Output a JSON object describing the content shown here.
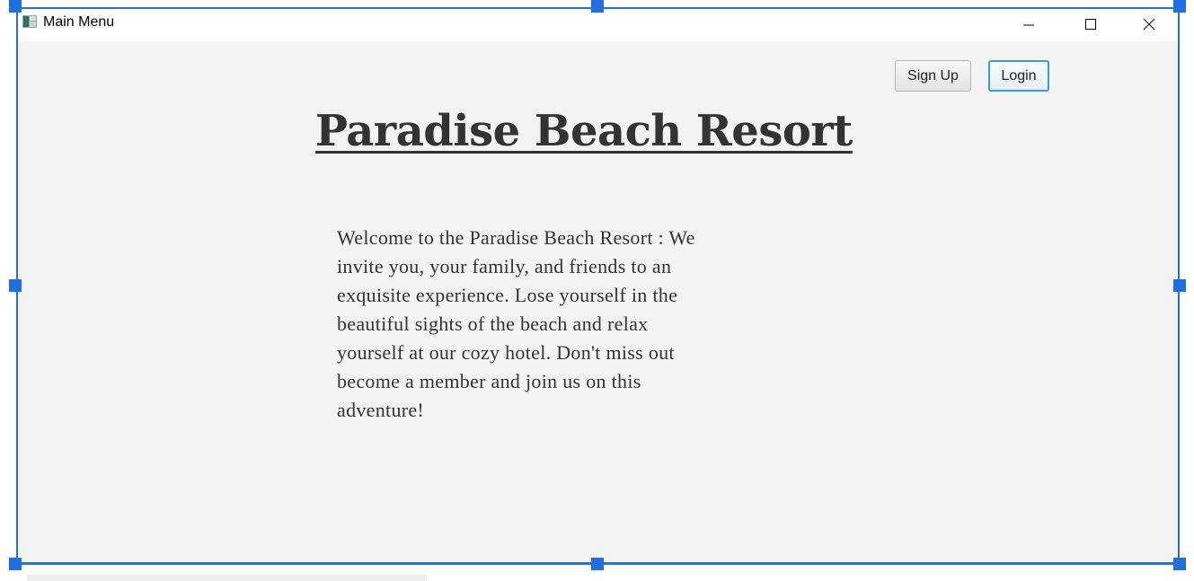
{
  "window": {
    "title": "Main Menu",
    "controls": {
      "minimize": "minimize-icon",
      "maximize": "maximize-icon",
      "close": "close-icon"
    }
  },
  "header": {
    "signup_label": "Sign Up",
    "login_label": "Login"
  },
  "main": {
    "heading": "Paradise Beach Resort",
    "welcome_lines": [
      "Welcome to the Paradise Beach Resort : We",
      "invite you, your family, and friends to an",
      "exquisite experience. Lose yourself in the",
      "beautiful sights of the beach and relax",
      "yourself at our cozy hotel. Don't miss out",
      "become a member and join us on this",
      "adventure!"
    ]
  },
  "colors": {
    "selection": "#2a6fd6",
    "focus_border": "#3d9ad8",
    "background": "#f3f3f3",
    "text": "#333333"
  }
}
